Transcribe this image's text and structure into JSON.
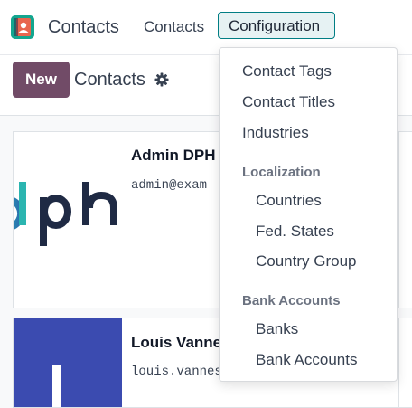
{
  "navbar": {
    "app_name": "Contacts",
    "menu": [
      {
        "label": "Contacts"
      },
      {
        "label": "Configuration"
      }
    ]
  },
  "control_panel": {
    "new_label": "New",
    "breadcrumb": "Contacts"
  },
  "dropdown": {
    "items": [
      "Contact Tags",
      "Contact Titles",
      "Industries"
    ],
    "sections": [
      {
        "header": "Localization",
        "items": [
          "Countries",
          "Fed. States",
          "Country Group"
        ]
      },
      {
        "header": "Bank Accounts",
        "items": [
          "Banks",
          "Bank Accounts"
        ]
      }
    ]
  },
  "cards": [
    {
      "name": "Admin DPH",
      "email": "admin@exam"
    },
    {
      "name": "Louis Vanne",
      "email": "louis.vanneste"
    }
  ],
  "colors": {
    "brand": "#714b67",
    "accent": "#017e84",
    "app_icon": "#13a68f"
  }
}
